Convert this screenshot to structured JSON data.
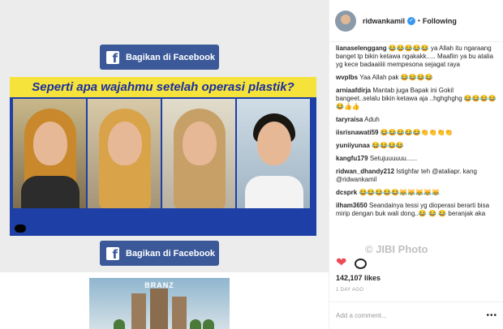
{
  "post": {
    "fb_share_top": "Bagikan di Facebook",
    "fb_share_bottom": "Bagikan di Facebook",
    "poster_headline": "Seperti apa wajahmu setelah operasi plastik?",
    "ad_brand": "BRANZ"
  },
  "sidebar": {
    "username": "ridwankamil",
    "verified_mark": "✓",
    "separator": "•",
    "follow_status": "Following",
    "comments": [
      {
        "user": "lianaselenggang",
        "text": "😂😂😂😂😂 ya Allah itu ngaraang banget tp bikin ketawa ngakakk..... Maafiin ya bu atalia yg kece badaaiiiii mempesona sejagat raya"
      },
      {
        "user": "wvplbs",
        "text": "Yaa Allah pak 😂😂😂😂"
      },
      {
        "user": "arniaafdirja",
        "text": "Mantab juga Bapak ini Gokil bangeet..selalu bikin ketawa aja ..hghghghg 😂😂😂😂😂👍👍"
      },
      {
        "user": "taryraisa",
        "text": "Aduh"
      },
      {
        "user": "iisrisnawati59",
        "text": "😂😂😂😂😂👏👏👏👏"
      },
      {
        "user": "yuniiyunaa",
        "text": "😂😂😂😂"
      },
      {
        "user": "kangfu179",
        "text": "Setujuuuuuu......"
      },
      {
        "user": "ridwan_dhandy212",
        "text": "Istighfar teh @ataliapr. kang @ridwankamil"
      },
      {
        "user": "dcsprk",
        "text": "😂😂😂😂😂😹😹😹😹😹"
      },
      {
        "user": "ilham3650",
        "text": "Seandainya tessi yg dioperasi berarti bisa mirip dengan buk wali dong..😂 😂 😂 beranjak aka"
      }
    ],
    "likes": "142,107 likes",
    "date": "1 DAY AGO",
    "add_comment_placeholder": "Add a comment...",
    "more_label": "•••",
    "watermark": "© JIBI Photo"
  },
  "icons": {
    "like": "heart-icon",
    "comment": "comment-icon",
    "facebook": "facebook-icon",
    "verified": "verified-badge-icon",
    "more": "more-options-icon"
  },
  "colors": {
    "facebook_blue": "#3b5998",
    "poster_yellow": "#f5e23a",
    "poster_blue": "#1d3fa6",
    "like_red": "#ed4956",
    "verified_blue": "#3897f0"
  }
}
